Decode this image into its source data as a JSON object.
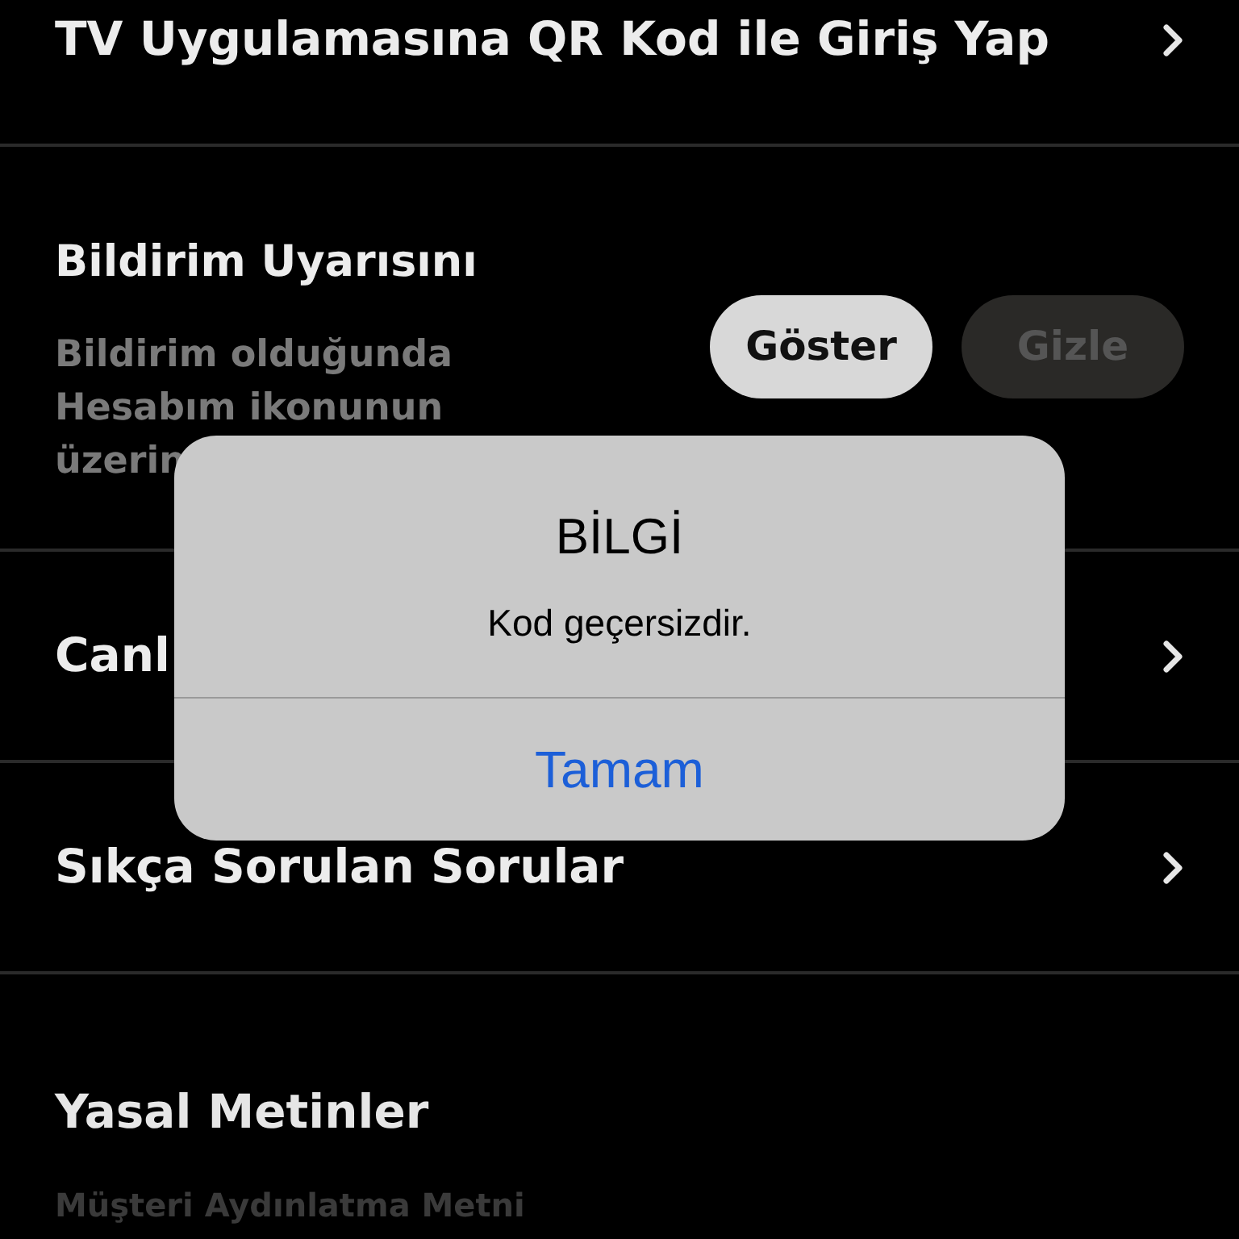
{
  "menu_rows": [
    {
      "kind": "link",
      "title": "TV Uygulamasına QR Kod ile Giriş Yap"
    },
    {
      "kind": "toggle",
      "title": "Bildirim Uyarısını",
      "description_lines": [
        "Bildirim olduğunda",
        "Hesabım ikonunun",
        "üzerin"
      ],
      "options": [
        {
          "label": "Göster",
          "selected": true
        },
        {
          "label": "Gizle",
          "selected": false
        }
      ]
    },
    {
      "kind": "link",
      "title": "Canl"
    },
    {
      "kind": "link",
      "title": "Sıkça Sorulan Sorular"
    },
    {
      "kind": "section",
      "title": "Yasal Metinler"
    },
    {
      "kind": "faded",
      "title": "Müşteri Aydınlatma Metni"
    }
  ],
  "alert": {
    "title": "BİLGİ",
    "message": "Kod geçersizdir.",
    "button": "Tamam"
  }
}
